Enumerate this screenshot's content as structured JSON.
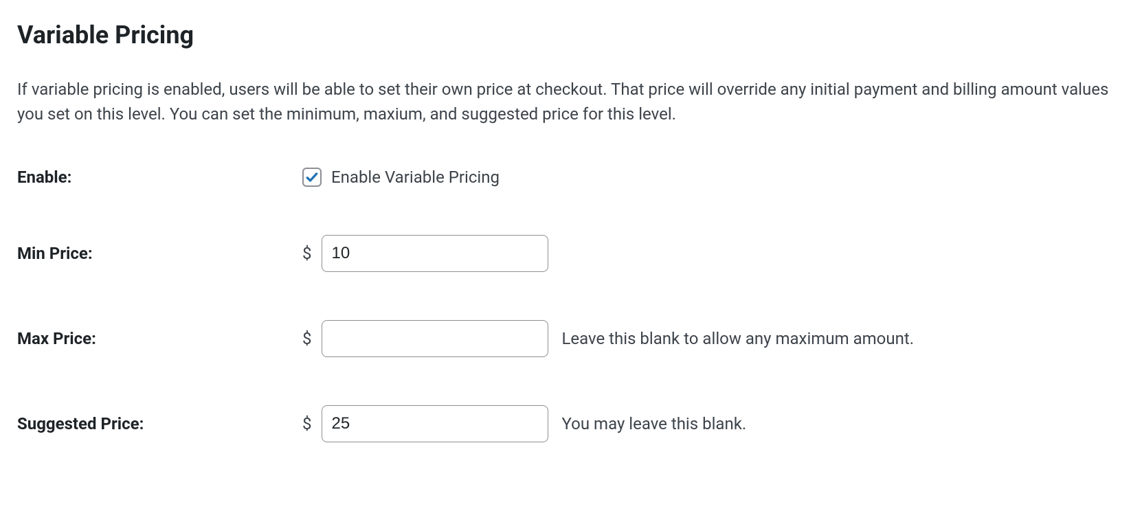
{
  "heading": "Variable Pricing",
  "description": "If variable pricing is enabled, users will be able to set their own price at checkout. That price will override any initial payment and billing amount values you set on this level. You can set the minimum, maxium, and suggested price for this level.",
  "currency_symbol": "$",
  "fields": {
    "enable": {
      "label": "Enable:",
      "checkbox_label": "Enable Variable Pricing",
      "checked": true
    },
    "min_price": {
      "label": "Min Price:",
      "value": "10"
    },
    "max_price": {
      "label": "Max Price:",
      "value": "",
      "help": "Leave this blank to allow any maximum amount."
    },
    "suggested_price": {
      "label": "Suggested Price:",
      "value": "25",
      "help": "You may leave this blank."
    }
  }
}
